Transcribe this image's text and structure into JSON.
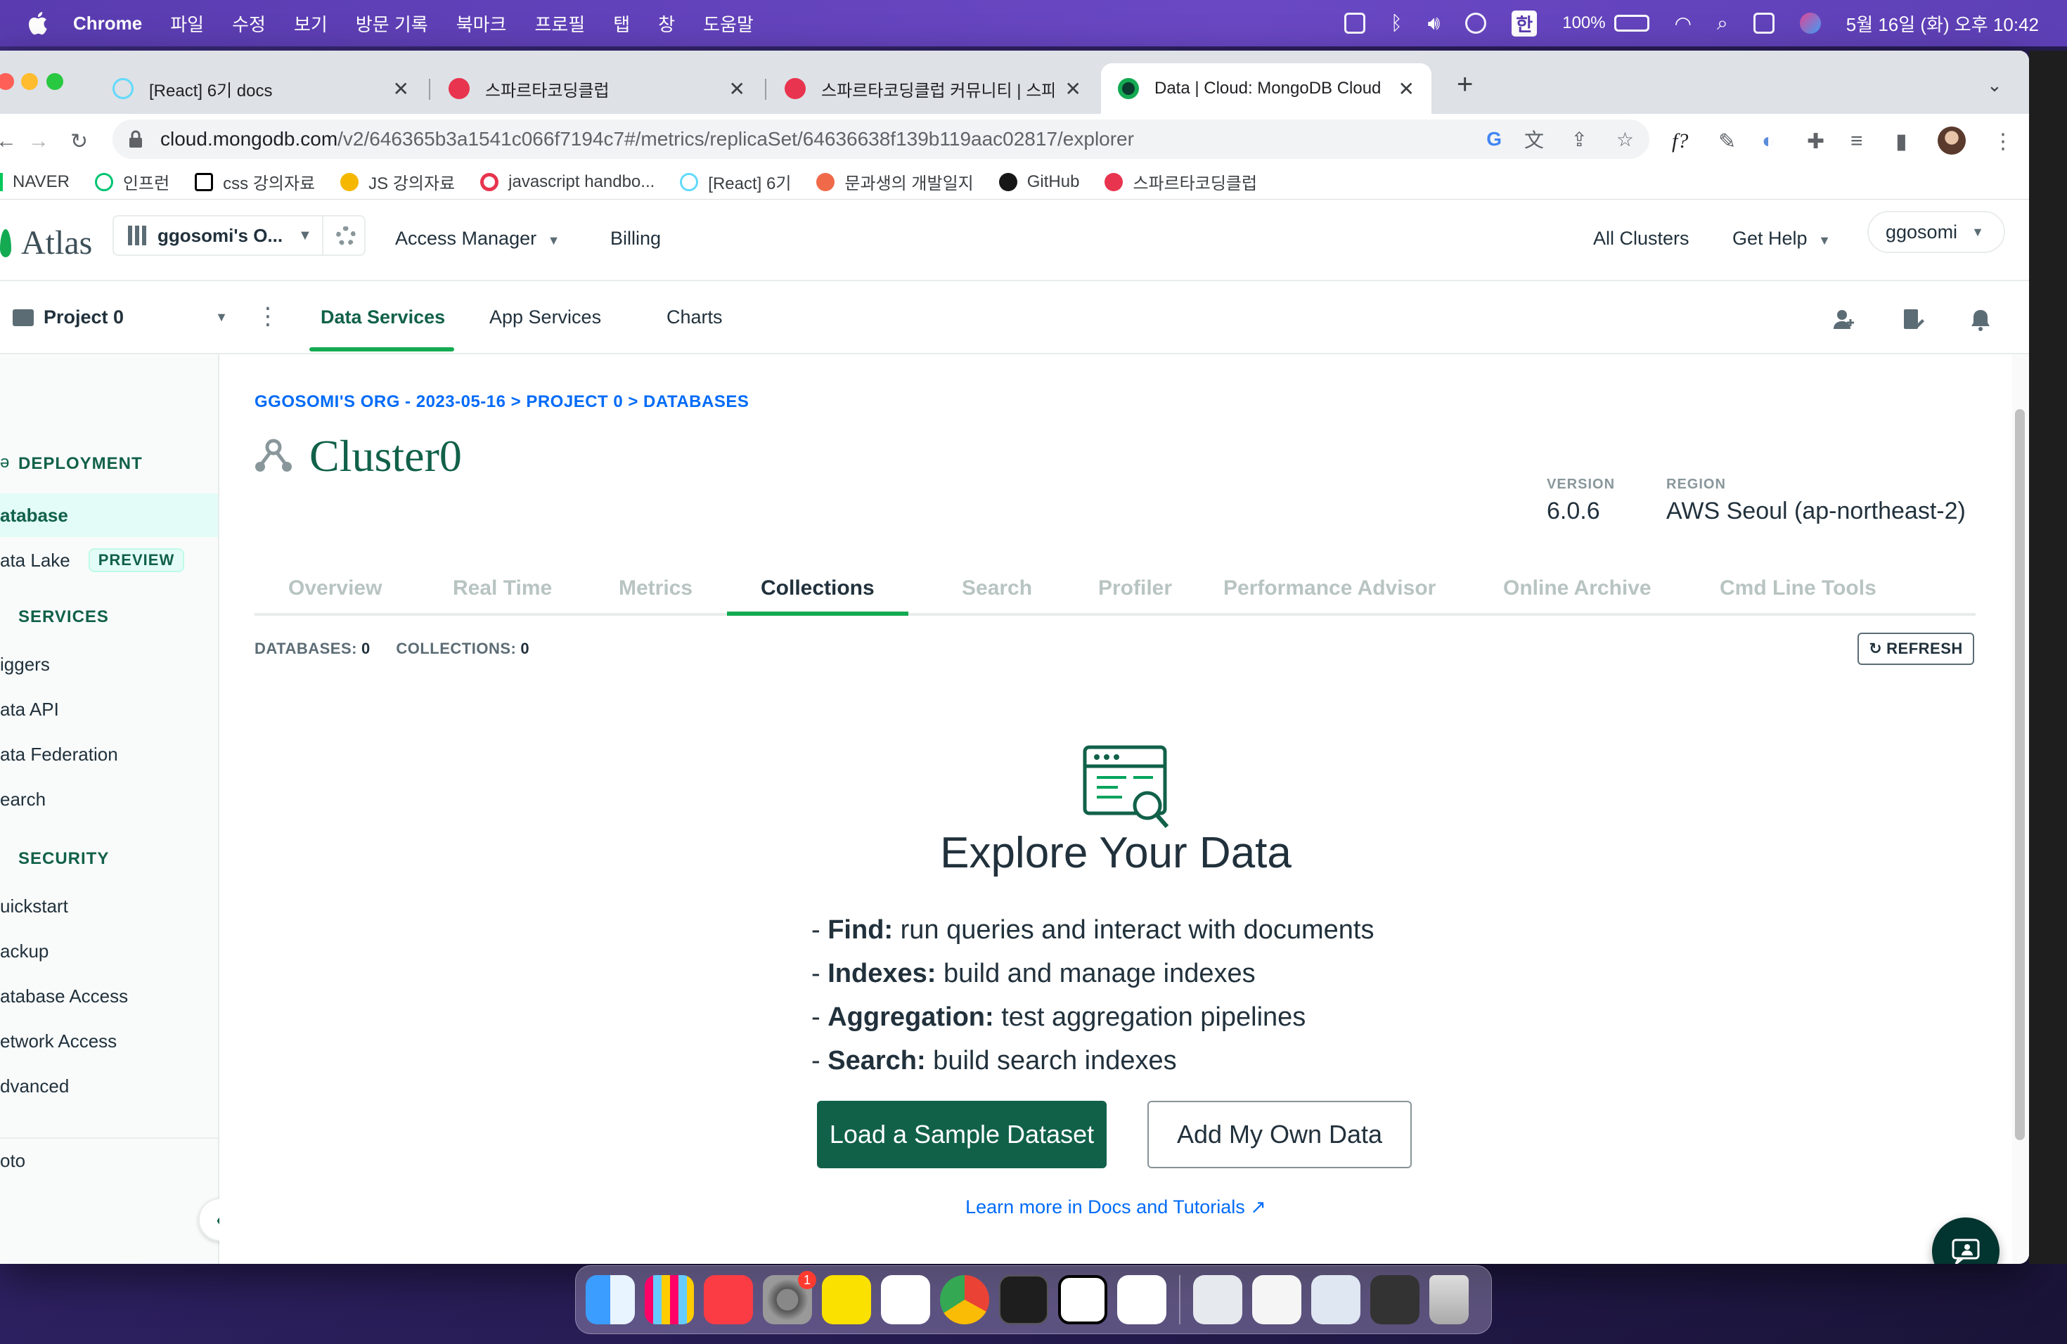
{
  "menubar": {
    "app": "Chrome",
    "items": [
      "파일",
      "수정",
      "보기",
      "방문 기록",
      "북마크",
      "프로필",
      "탭",
      "창",
      "도움말"
    ],
    "battery": "100%",
    "ime": "한",
    "datetime": "5월 16일 (화) 오후 10:42"
  },
  "browser": {
    "tabs": [
      {
        "title": "[React] 6기 docs",
        "favicon_color": "#61dafb"
      },
      {
        "title": "스파르타코딩클럽",
        "favicon_color": "#e8344e"
      },
      {
        "title": "스파르타코딩클럽 커뮤니티 | 스파르타",
        "favicon_color": "#e8344e"
      },
      {
        "title": "Data | Cloud: MongoDB Cloud",
        "favicon_color": "#13aa52",
        "active": true
      }
    ],
    "new_tab": "+",
    "url_host": "cloud.mongodb.com",
    "url_path": "/v2/646365b3a1541c066f7194c7#/metrics/replicaSet/64636638f139b119aac02817/explorer",
    "bookmarks": [
      {
        "label": "NAVER",
        "color": "#03c75a"
      },
      {
        "label": "인프런",
        "color": "#00c471"
      },
      {
        "label": "css 강의자료",
        "color": "#000000"
      },
      {
        "label": "JS 강의자료",
        "color": "#f5b700"
      },
      {
        "label": "javascript handbo...",
        "color": "#e8344e"
      },
      {
        "label": "[React] 6기",
        "color": "#61dafb"
      },
      {
        "label": "문과생의 개발일지",
        "color": "#f06a4a"
      },
      {
        "label": "GitHub",
        "color": "#181717"
      },
      {
        "label": "스파르타코딩클럽",
        "color": "#e8344e"
      }
    ]
  },
  "atlas": {
    "logo": "Atlas",
    "org": "ggosomi's O...",
    "nav": [
      "Access Manager",
      "Billing"
    ],
    "right_nav": [
      "All Clusters",
      "Get Help"
    ],
    "user": "ggosomi",
    "project": "Project 0",
    "sections": [
      "Data Services",
      "App Services",
      "Charts"
    ],
    "active_section": "Data Services"
  },
  "sidebar": {
    "deployment_header": "DEPLOYMENT",
    "deployment": [
      {
        "label": "atabase",
        "active": true
      },
      {
        "label": "ata Lake",
        "badge": "PREVIEW"
      }
    ],
    "services_header": "SERVICES",
    "services": [
      "iggers",
      "ata API",
      "ata Federation",
      "earch"
    ],
    "security_header": "SECURITY",
    "security": [
      "uickstart",
      "ackup",
      "atabase Access",
      "etwork Access",
      "dvanced"
    ],
    "footer": "oto"
  },
  "cluster": {
    "breadcrumb": "GGOSOMI'S ORG - 2023-05-16 > PROJECT 0 > DATABASES",
    "name": "Cluster0",
    "version_label": "VERSION",
    "version": "6.0.6",
    "region_label": "REGION",
    "region": "AWS Seoul (ap-northeast-2)",
    "tabs": [
      "Overview",
      "Real Time",
      "Metrics",
      "Collections",
      "Search",
      "Profiler",
      "Performance Advisor",
      "Online Archive",
      "Cmd Line Tools"
    ],
    "active_tab": "Collections",
    "databases_label": "DATABASES:",
    "databases_count": "0",
    "collections_label": "COLLECTIONS:",
    "collections_count": "0",
    "refresh": "REFRESH"
  },
  "empty_state": {
    "title": "Explore Your Data",
    "features": [
      {
        "bold": "Find:",
        "text": " run queries and interact with documents"
      },
      {
        "bold": "Indexes:",
        "text": " build and manage indexes"
      },
      {
        "bold": "Aggregation:",
        "text": " test aggregation pipelines"
      },
      {
        "bold": "Search:",
        "text": " build search indexes"
      }
    ],
    "primary_button": "Load a Sample Dataset",
    "secondary_button": "Add My Own Data",
    "learn_more": "Learn more in Docs and Tutorials"
  },
  "dock": {
    "badge": "1"
  }
}
